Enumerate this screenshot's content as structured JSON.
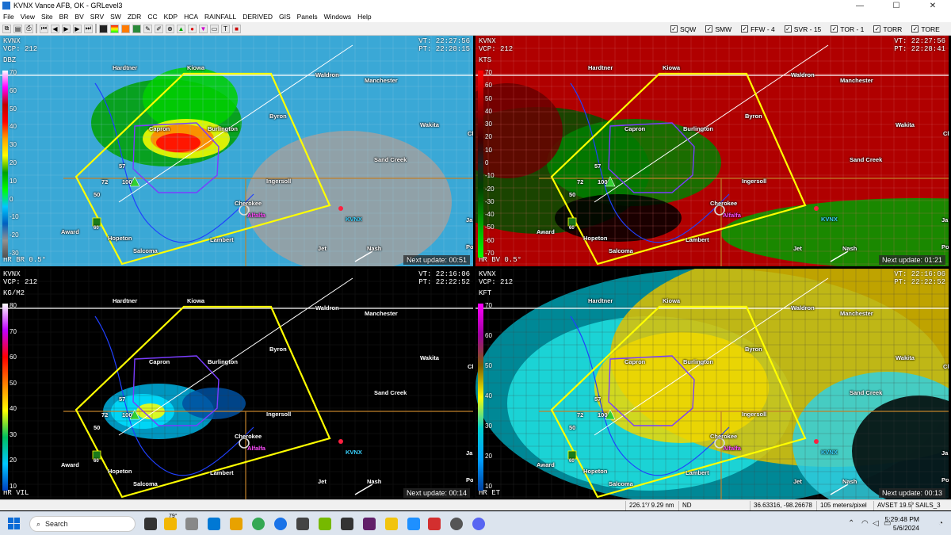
{
  "window": {
    "title": "KVNX Vance AFB, OK - GRLevel3",
    "minimize": "—",
    "maximize": "☐",
    "close": "✕"
  },
  "menu": [
    "File",
    "View",
    "Site",
    "BR",
    "BV",
    "SRV",
    "SW",
    "ZDR",
    "CC",
    "KDP",
    "HCA",
    "RAINFALL",
    "DERIVED",
    "GIS",
    "Panels",
    "Windows",
    "Help"
  ],
  "toolbar": {
    "icons": [
      "copy-icon",
      "paste-icon",
      "print-icon",
      "first-frame-icon",
      "previous-frame-icon",
      "play-icon",
      "next-frame-icon",
      "last-frame-icon",
      "stop-icon",
      "color-table-icon",
      "palette-icon",
      "layers-icon",
      "edit-icon",
      "draw-icon",
      "zoom-in-icon",
      "triangle-icon",
      "target-icon",
      "warning-icon",
      "ruler-icon",
      "text-icon",
      "record-icon"
    ]
  },
  "toggles": [
    {
      "label": "SQW",
      "checked": true
    },
    {
      "label": "SMW",
      "checked": true
    },
    {
      "label": "FFW - 4",
      "checked": true
    },
    {
      "label": "SVR - 15",
      "checked": true
    },
    {
      "label": "TOR - 1",
      "checked": true
    },
    {
      "label": "TORR",
      "checked": true
    },
    {
      "label": "TORE",
      "checked": true
    }
  ],
  "panels": [
    {
      "site": "KVNX",
      "vcp": "VCP: 212",
      "vt": "VT: 22:27:56",
      "pt": "PT: 22:28:15",
      "unit": "DBZ",
      "product": "HR BR 0.5°",
      "next_update": "Next update: 00:51",
      "scale_ticks": [
        "70",
        "60",
        "50",
        "40",
        "30",
        "20",
        "10",
        "0",
        "-10",
        "-20",
        "-30"
      ],
      "scale_colors": [
        "#ffffff",
        "#ff00ff",
        "#c00000",
        "#ff0000",
        "#ffa000",
        "#ffff00",
        "#00a000",
        "#00ff00",
        "#00c8ff",
        "#0060c0",
        "#909090",
        "#505050"
      ]
    },
    {
      "site": "KVNX",
      "vcp": "VCP: 212",
      "vt": "VT: 22:27:56",
      "pt": "PT: 22:28:41",
      "unit": "KTS",
      "product": "HR BV 0.5°",
      "next_update": "Next update: 01:21",
      "scale_ticks": [
        "70",
        "60",
        "50",
        "40",
        "30",
        "20",
        "10",
        "0",
        "-10",
        "-20",
        "-30",
        "-40",
        "-50",
        "-60",
        "-70"
      ],
      "scale_colors": [
        "#ff0000",
        "#c00000",
        "#800000",
        "#400000",
        "#202020",
        "#004000",
        "#008000",
        "#00c000",
        "#00ff00"
      ]
    },
    {
      "site": "KVNX",
      "vcp": "VCP: 212",
      "vt": "VT: 22:16:06",
      "pt": "PT: 22:22:52",
      "unit": "KG/M2",
      "product": "HR VIL",
      "next_update": "Next update: 00:14",
      "scale_ticks": [
        "80",
        "70",
        "60",
        "50",
        "40",
        "30",
        "20",
        "10"
      ],
      "scale_colors": [
        "#ffffff",
        "#c000ff",
        "#ff0000",
        "#ff8000",
        "#ffff00",
        "#00c060",
        "#00c8ff",
        "#0040c0"
      ]
    },
    {
      "site": "KVNX",
      "vcp": "VCP: 212",
      "vt": "VT: 22:16:06",
      "pt": "PT: 22:22:52",
      "unit": "KFT",
      "product": "HR ET",
      "next_update": "Next update: 00:13",
      "scale_ticks": [
        "70",
        "60",
        "50",
        "40",
        "30",
        "20",
        "10"
      ],
      "scale_colors": [
        "#ff00ff",
        "#a000a0",
        "#806000",
        "#ffff00",
        "#00d0d0",
        "#00a0ff",
        "#0040a0"
      ]
    }
  ],
  "cities": [
    {
      "name": "Hardtner",
      "style": "white"
    },
    {
      "name": "Kiowa",
      "style": "white"
    },
    {
      "name": "Waldron",
      "style": "white"
    },
    {
      "name": "Manchester",
      "style": "white"
    },
    {
      "name": "Capron",
      "style": "white"
    },
    {
      "name": "Burlington",
      "style": "white"
    },
    {
      "name": "Byron",
      "style": "white"
    },
    {
      "name": "Wakita",
      "style": "white"
    },
    {
      "name": "Clyd",
      "style": "white"
    },
    {
      "name": "Sand Creek",
      "style": "white"
    },
    {
      "name": "Ingersoll",
      "style": "white"
    },
    {
      "name": "Cherokee",
      "style": "white"
    },
    {
      "name": "Alfalfa",
      "style": "mag"
    },
    {
      "name": "KVNX",
      "style": "cy"
    },
    {
      "name": "Award",
      "style": "white"
    },
    {
      "name": "Hopeton",
      "style": "white"
    },
    {
      "name": "Lambert",
      "style": "white"
    },
    {
      "name": "Jet",
      "style": "white"
    },
    {
      "name": "Nash",
      "style": "white"
    },
    {
      "name": "Salcoma",
      "style": "white"
    },
    {
      "name": "Pon",
      "style": "white"
    },
    {
      "name": "Ja",
      "style": "white"
    }
  ],
  "markers": {
    "hail_72": "72",
    "hail_57": "57",
    "hail_50": "50",
    "pct_100": "100",
    "shield_60": "60"
  },
  "status": {
    "range": "226.1°/ 9.29 nm",
    "value": "ND",
    "latlon": "36.63316, -98.26678",
    "resolution": "105 meters/pixel",
    "avset": "AVSET 19.5°",
    "sails": "SAILS_3"
  },
  "taskbar": {
    "search_placeholder": "Search",
    "temp": "79°",
    "time": "5:29:48 PM",
    "date": "5/6/2024"
  }
}
